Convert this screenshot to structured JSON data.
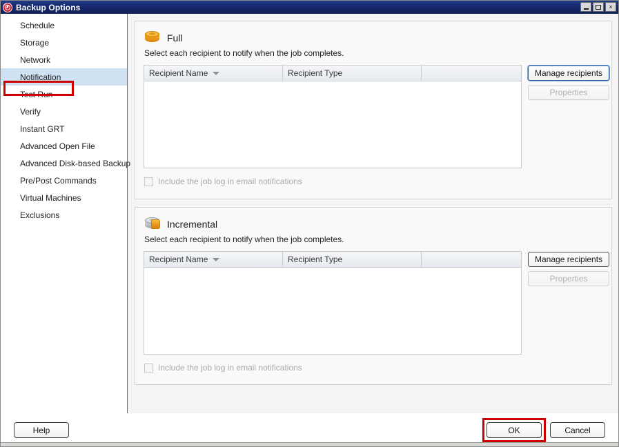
{
  "window": {
    "title": "Backup Options",
    "icon": "backup-exec-logo-icon",
    "controls": {
      "minimize": "minimize-icon",
      "maximize": "maximize-icon",
      "close": "×"
    }
  },
  "sidebar": {
    "items": [
      {
        "label": "Schedule",
        "selected": false
      },
      {
        "label": "Storage",
        "selected": false
      },
      {
        "label": "Network",
        "selected": false
      },
      {
        "label": "Notification",
        "selected": true
      },
      {
        "label": "Test Run",
        "selected": false
      },
      {
        "label": "Verify",
        "selected": false
      },
      {
        "label": "Instant GRT",
        "selected": false
      },
      {
        "label": "Advanced Open File",
        "selected": false
      },
      {
        "label": "Advanced Disk-based Backup",
        "selected": false
      },
      {
        "label": "Pre/Post Commands",
        "selected": false
      },
      {
        "label": "Virtual Machines",
        "selected": false
      },
      {
        "label": "Exclusions",
        "selected": false
      }
    ],
    "highlight_color": "#cc0000",
    "selected_bg": "#cfe2f3"
  },
  "sections": [
    {
      "title": "Full",
      "icon": "full-backup-disk-icon",
      "description": "Select each recipient to notify when the job completes.",
      "table": {
        "columns": [
          "Recipient Name",
          "Recipient Type",
          ""
        ],
        "sort_column": "Recipient Name",
        "sort_direction": "descending",
        "rows": []
      },
      "buttons": {
        "manage": "Manage recipients",
        "manage_focused": true,
        "properties": "Properties",
        "properties_disabled": true
      },
      "checkbox": {
        "label": "Include the job log in email notifications",
        "checked": false,
        "disabled": true
      }
    },
    {
      "title": "Incremental",
      "icon": "incremental-backup-disk-icon",
      "description": "Select each recipient to notify when the job completes.",
      "table": {
        "columns": [
          "Recipient Name",
          "Recipient Type",
          ""
        ],
        "sort_column": "Recipient Name",
        "sort_direction": "descending",
        "rows": []
      },
      "buttons": {
        "manage": "Manage recipients",
        "manage_focused": false,
        "properties": "Properties",
        "properties_disabled": true
      },
      "checkbox": {
        "label": "Include the job log in email notifications",
        "checked": false,
        "disabled": true
      }
    }
  ],
  "footer": {
    "help": "Help",
    "ok": "OK",
    "cancel": "Cancel",
    "ok_highlight_color": "#cc0000"
  }
}
